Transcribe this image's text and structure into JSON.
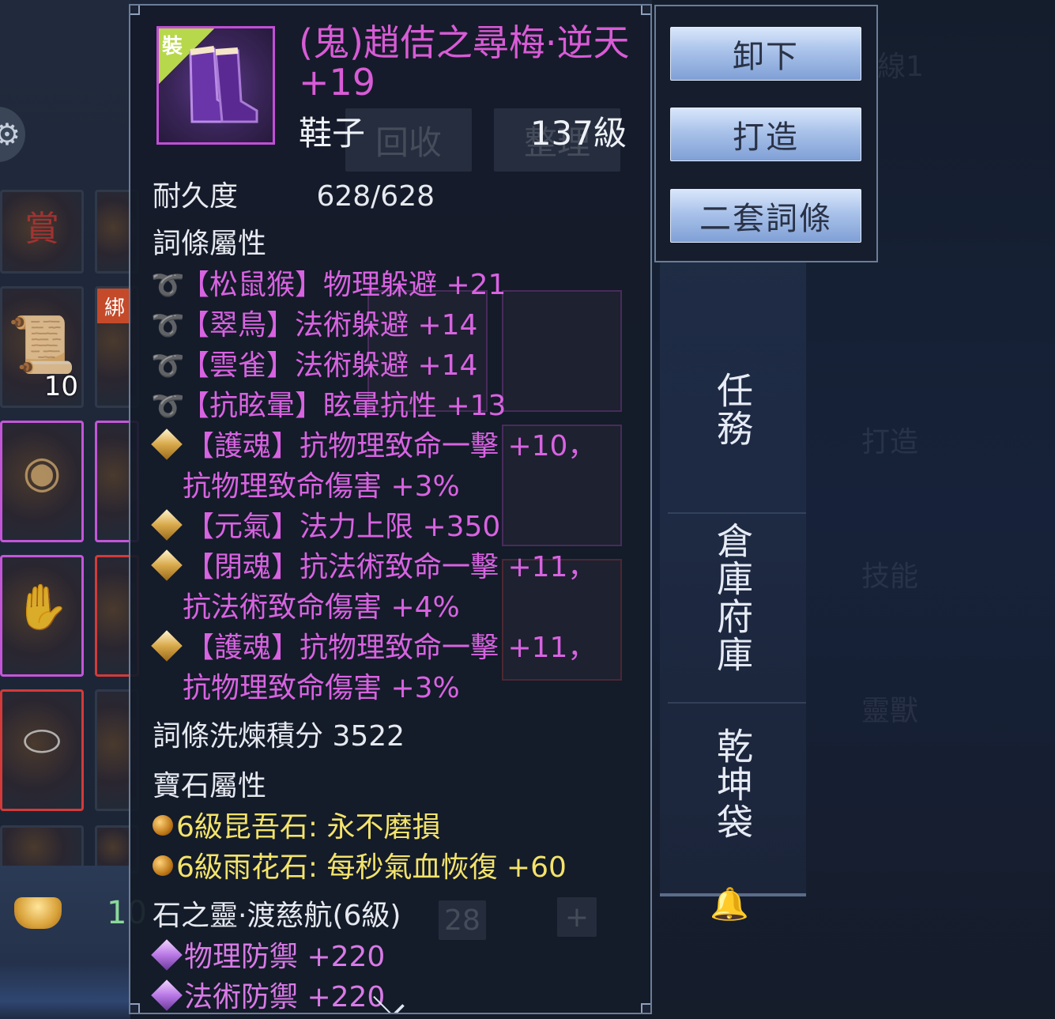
{
  "item": {
    "equip_tag": "裝",
    "name": "(鬼)趙佶之尋梅·逆天 +19",
    "type": "鞋子",
    "level": "137級",
    "durability_label": "耐久度",
    "durability_value": "628/628",
    "rarity_color": "#d95bd6"
  },
  "affix_section": {
    "title": "詞條屬性",
    "affixes": [
      {
        "icon": "swirl-icon",
        "text": "【松鼠猴】物理躲避 +21"
      },
      {
        "icon": "swirl-icon",
        "text": "【翠鳥】法術躲避 +14"
      },
      {
        "icon": "swirl-icon",
        "text": "【雲雀】法術躲避 +14"
      },
      {
        "icon": "swirl-icon",
        "text": "【抗眩暈】眩暈抗性 +13"
      },
      {
        "icon": "diamond-icon",
        "text": "【護魂】抗物理致命一擊 +10，",
        "cont": "抗物理致命傷害 +3%"
      },
      {
        "icon": "diamond-icon",
        "text": "【元氣】法力上限 +350"
      },
      {
        "icon": "diamond-icon",
        "text": "【閉魂】抗法術致命一擊 +11，",
        "cont": "抗法術致命傷害 +4%"
      },
      {
        "icon": "diamond-icon",
        "text": "【護魂】抗物理致命一擊 +11，",
        "cont": "抗物理致命傷害 +3%"
      }
    ],
    "refine_score": "詞條洗煉積分 3522"
  },
  "gem_section": {
    "title": "寶石屬性",
    "gems": [
      "6級昆吾石: 永不磨損",
      "6級雨花石: 每秒氣血恢復 +60"
    ]
  },
  "spirit_section": {
    "title": "石之靈·渡慈航(6級)",
    "stats": [
      "物理防禦 +220",
      "法術防禦 +220"
    ]
  },
  "actions": {
    "unequip": "卸下",
    "forge": "打造",
    "second_affix": "二套詞條"
  },
  "background": {
    "recycle_tab": "回收",
    "tidy_tab": "整理",
    "slot_count": "10",
    "bind_tag": "綁",
    "currency_value": "10",
    "bag_count": "28",
    "plus_label": "+"
  },
  "side_nav": [
    "任務",
    "倉庫府庫",
    "乾坤袋"
  ],
  "colors": {
    "affix": "#d863e1",
    "gem": "#f3e36a",
    "button_blue": "#a9c2ea"
  }
}
